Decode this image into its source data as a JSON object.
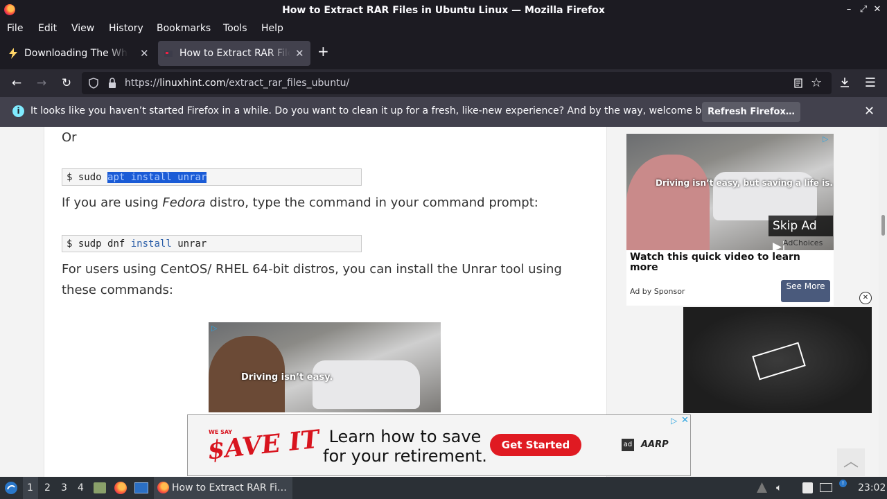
{
  "window": {
    "title": "How to Extract RAR Files in Ubuntu Linux — Mozilla Firefox",
    "controls": [
      "–",
      "⤢",
      "✕"
    ]
  },
  "menubar": {
    "items": [
      "File",
      "Edit",
      "View",
      "History",
      "Bookmarks",
      "Tools",
      "Help"
    ]
  },
  "tabs": [
    {
      "label": "Downloading The White House",
      "active": false
    },
    {
      "label": "How to Extract RAR Files in Ubuntu Linux",
      "active": true
    }
  ],
  "newtab_label": "+",
  "navbar": {
    "url_prefix": "https://",
    "url_domain": "linuxhint.com",
    "url_path": "/extract_rar_files_ubuntu/"
  },
  "notification": {
    "message": "It looks like you haven’t started Firefox in a while. Do you want to clean it up for a fresh, like-new experience? And by the way, welcome back!",
    "button": "Refresh Firefox…"
  },
  "article": {
    "or_text": "Or",
    "code1": {
      "prompt": "$",
      "cmd": "sudo",
      "selected": "apt install unrar"
    },
    "fedora_pre": "If you are using ",
    "fedora_em": "Fedora",
    "fedora_post": " distro, type the command in your command prompt:",
    "code2": {
      "prompt": "$",
      "cmd": "sudp dnf",
      "kw": "install",
      "arg": "unrar"
    },
    "centos_text": "For users using CentOS/ RHEL 64-bit distros, you can install the Unrar tool using these commands:",
    "inline_ad_caption": "Driving isn’t easy."
  },
  "sidebar_ad": {
    "caption": "Driving isn’t easy, but saving a life is.",
    "skip": "Skip Ad",
    "adchoices": "AdChoices",
    "headline": "Watch this quick video to learn more",
    "byline": "Ad by Sponsor",
    "cta": "See More"
  },
  "banner_ad": {
    "we_say": "WE SAY",
    "save_it": "$AVE IT",
    "headline_line1": "Learn how to save",
    "headline_line2": "for your retirement.",
    "cta": "Get Started",
    "brand": "AARP",
    "ad_mark": "ad"
  },
  "taskbar": {
    "workspaces": [
      "1",
      "2",
      "3",
      "4"
    ],
    "active_workspace": "1",
    "task_label": "How to Extract RAR Fi…",
    "clock": "23:02"
  },
  "colors": {
    "chrome_dark": "#1c1b22",
    "toolbar": "#2b2a33",
    "selection": "#1a5bd6",
    "cta_red": "#e01a22"
  }
}
